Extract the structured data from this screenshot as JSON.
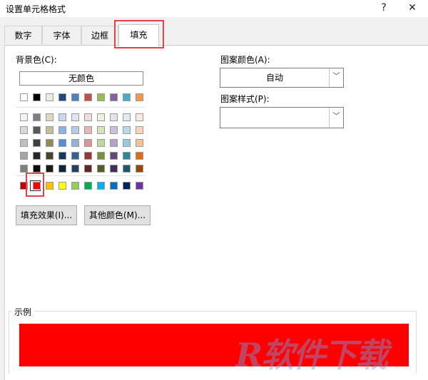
{
  "window": {
    "title": "设置单元格格式",
    "help_glyph": "?",
    "close_glyph": "✕"
  },
  "tabs": [
    "数字",
    "字体",
    "边框",
    "填充"
  ],
  "active_tab": "填充",
  "background": {
    "label": "背景色(C):",
    "no_color_button": "无颜色",
    "theme_top_row": [
      "#ffffff",
      "#000000",
      "#eeece1",
      "#1f497d",
      "#4f81bd",
      "#c0504d",
      "#9bbb59",
      "#8064a2",
      "#4bacc6",
      "#f79646"
    ],
    "tint_rows": [
      [
        "#f2f2f2",
        "#7f7f7f",
        "#ddd9c3",
        "#c6d9f0",
        "#dbe5f1",
        "#f2dcdb",
        "#ebf1dd",
        "#e5e0ec",
        "#dbeef3",
        "#fdeada"
      ],
      [
        "#d8d8d8",
        "#595959",
        "#c4bd97",
        "#8db3e2",
        "#b8cce4",
        "#e5b9b7",
        "#d7e3bc",
        "#ccc1d9",
        "#b7dde8",
        "#fbd5b5"
      ],
      [
        "#bfbfbf",
        "#3f3f3f",
        "#938953",
        "#548dd4",
        "#95b3d7",
        "#d99694",
        "#c3d69b",
        "#b2a2c7",
        "#92cddc",
        "#fac08f"
      ],
      [
        "#a5a5a5",
        "#262626",
        "#494429",
        "#17365d",
        "#366092",
        "#953734",
        "#76923c",
        "#5f497a",
        "#31859b",
        "#e36c09"
      ],
      [
        "#7f7f7f",
        "#0c0c0c",
        "#1d1b10",
        "#0f243e",
        "#244061",
        "#632423",
        "#4f6128",
        "#3f3151",
        "#205867",
        "#974806"
      ]
    ],
    "standard_row": [
      "#c00000",
      "#ff0000",
      "#ffc000",
      "#ffff00",
      "#92d050",
      "#00b050",
      "#00b0f0",
      "#0070c0",
      "#002060",
      "#7030a0"
    ],
    "selected_color": "#ff0000",
    "fill_effects_button": "填充效果(I)...",
    "more_colors_button": "其他颜色(M)..."
  },
  "pattern": {
    "color_label": "图案颜色(A):",
    "color_value": "自动",
    "style_label": "图案样式(P):",
    "style_value": ""
  },
  "sample": {
    "label": "示例",
    "fill_color": "#ff0000"
  },
  "watermark": "R软件下载"
}
